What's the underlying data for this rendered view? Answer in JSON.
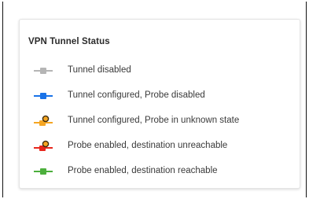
{
  "legend": {
    "title": "VPN Tunnel Status",
    "items": [
      {
        "label": "Tunnel disabled",
        "color": "#b5b5b5",
        "icon": "square-marker-icon"
      },
      {
        "label": "Tunnel configured, Probe disabled",
        "color": "#1a73e8",
        "icon": "square-marker-icon"
      },
      {
        "label": "Tunnel configured, Probe in unknown state",
        "color": "#f5a623",
        "icon": "probe-marker-icon"
      },
      {
        "label": "Probe enabled, destination unreachable",
        "color": "#e8261c",
        "icon": "probe-marker-icon"
      },
      {
        "label": "Probe enabled, destination reachable",
        "color": "#4caf3c",
        "icon": "square-marker-icon"
      }
    ]
  }
}
